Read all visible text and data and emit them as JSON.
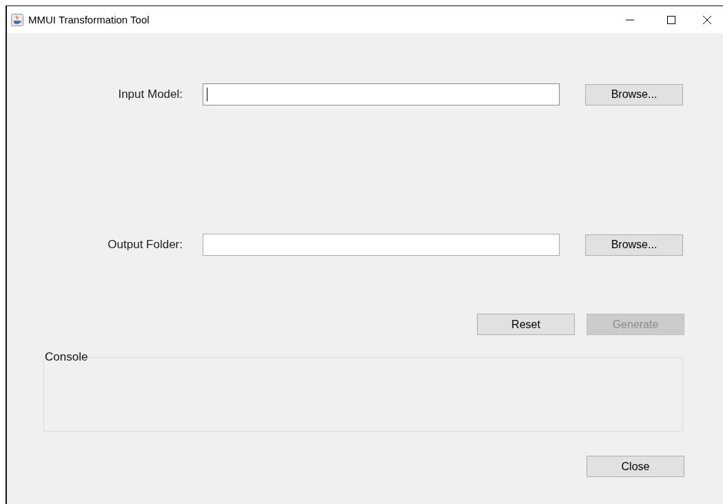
{
  "window": {
    "title": "MMUI Transformation Tool"
  },
  "fields": [
    {
      "label": "Input Model:",
      "focused": true,
      "button": {
        "label": "Browse...",
        "disabled": false
      }
    },
    {
      "label": "Output Folder:",
      "focused": false,
      "button": {
        "label": "Browse...",
        "disabled": false
      }
    }
  ],
  "actions": [
    {
      "label": "Reset",
      "disabled": false
    },
    {
      "label": "Generate",
      "disabled": true
    }
  ],
  "console": {
    "title": "Console"
  },
  "footer_buttons": [
    {
      "label": "Close",
      "disabled": false
    }
  ]
}
